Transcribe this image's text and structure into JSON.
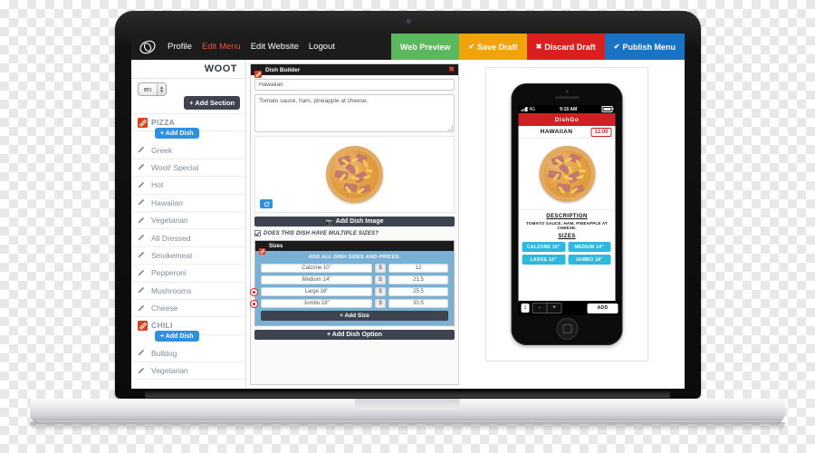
{
  "topbar": {
    "logo_icon": "swirl-logo-icon",
    "nav": [
      {
        "label": "Profile",
        "active": false
      },
      {
        "label": "Edit Menu",
        "active": true
      },
      {
        "label": "Edit Website",
        "active": false
      },
      {
        "label": "Logout",
        "active": false
      }
    ],
    "actions": [
      {
        "label": "Web Preview",
        "glyph": "",
        "color": "#5cb85c"
      },
      {
        "label": "Save Draft",
        "glyph": "✔",
        "color": "#f0a30a"
      },
      {
        "label": "Discard Draft",
        "glyph": "✖",
        "color": "#d9201f"
      },
      {
        "label": "Publish Menu",
        "glyph": "✔",
        "color": "#1a72c4"
      }
    ]
  },
  "sidebar": {
    "title": "WOOT",
    "language": "en",
    "add_section_label": "+ Add Section",
    "add_dish_label": "+ Add Dish",
    "items": [
      {
        "label": "PIZZA",
        "type": "section",
        "icon": "section-icon"
      },
      {
        "label": "Greek",
        "type": "dish",
        "icon": "pencil-icon"
      },
      {
        "label": "Woot! Special",
        "type": "dish",
        "icon": "pencil-icon"
      },
      {
        "label": "Hot",
        "type": "dish",
        "icon": "pencil-icon"
      },
      {
        "label": "Hawaiian",
        "type": "dish",
        "icon": "pencil-icon"
      },
      {
        "label": "Vegetarian",
        "type": "dish",
        "icon": "pencil-icon"
      },
      {
        "label": "All Dressed",
        "type": "dish",
        "icon": "pencil-icon"
      },
      {
        "label": "Smokemeat",
        "type": "dish",
        "icon": "pencil-icon"
      },
      {
        "label": "Pepperoni",
        "type": "dish",
        "icon": "pencil-icon"
      },
      {
        "label": "Mushrooms",
        "type": "dish",
        "icon": "pencil-icon"
      },
      {
        "label": "Cheese",
        "type": "dish",
        "icon": "pencil-icon"
      },
      {
        "label": "CHILI",
        "type": "section",
        "icon": "section-icon"
      },
      {
        "label": "Bulldog",
        "type": "dish",
        "icon": "pencil-icon"
      },
      {
        "label": "Vegetarian",
        "type": "dish",
        "icon": "pencil-icon"
      }
    ]
  },
  "builder": {
    "title": "Dish Builder",
    "close_icon": "close-icon",
    "panel_icon": "dish-icon",
    "name_value": "Hawaiian",
    "description_value": "Tomato sauce, ham, pineapple at cheese.",
    "edit_image_icon": "refresh-image-icon",
    "add_image_label": "Add Dish Image",
    "add_image_icon": "image-icon",
    "multiple_sizes_question": "DOES THIS DISH HAVE MULTIPLE SIZES?",
    "multiple_sizes_checked": true,
    "sizes_panel_title": "Sizes",
    "sizes_caption": "ADD ALL DISH SIZES AND PRICES.",
    "currency_symbol": "$",
    "sizes": [
      {
        "name": "Calzone 10\"",
        "price": "12",
        "deletable": false
      },
      {
        "name": "Medium 14\"",
        "price": "21.5",
        "deletable": false
      },
      {
        "name": "Large 16\"",
        "price": "25.5",
        "deletable": true
      },
      {
        "name": "Jumbo 18\"",
        "price": "30.5",
        "deletable": true
      }
    ],
    "add_size_label": "+ Add Size",
    "add_dish_option_label": "+ Add Dish Option"
  },
  "phone_preview": {
    "status_time": "9:15 AM",
    "status_network": "4G",
    "brand": "DishGo",
    "dish_name": "HAWAIIAN",
    "price": "12.00",
    "description_heading": "DESCRIPTION",
    "description_text": "TOMATO SAUCE, HAM, PINEAPPLE AT CHEESE.",
    "sizes_heading": "SIZES",
    "sizes": [
      "CALZONE 10\"",
      "MEDIUM 14\"",
      "LARGE 16\"",
      "JUMBO 18\""
    ],
    "quantity": "1",
    "minus_label": "-",
    "plus_label": "+",
    "add_label": "ADD"
  }
}
